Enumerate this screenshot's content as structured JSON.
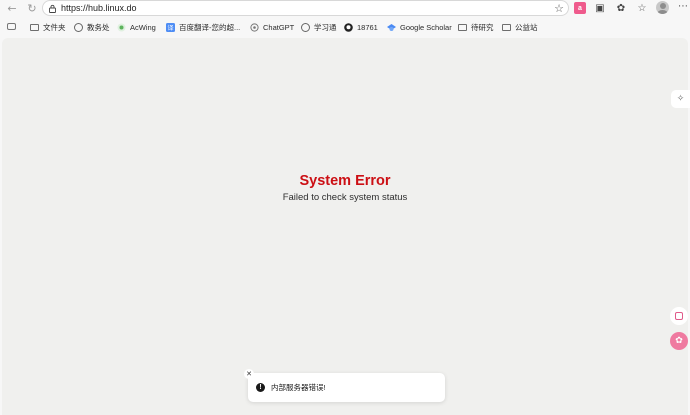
{
  "browser": {
    "url": "https://hub.linux.do"
  },
  "bookmarks": [
    {
      "label": "文件夹",
      "icon": "folder-icon"
    },
    {
      "label": "教务处",
      "icon": "globe-icon"
    },
    {
      "label": "AcWing",
      "icon": "acwing-icon"
    },
    {
      "label": "百度翻译-您的超...",
      "icon": "baidu-translate-icon"
    },
    {
      "label": "ChatGPT",
      "icon": "chatgpt-icon"
    },
    {
      "label": "学习通",
      "icon": "globe-icon"
    },
    {
      "label": "18761",
      "icon": "github-icon"
    },
    {
      "label": "Google Scholar",
      "icon": "scholar-icon"
    },
    {
      "label": "待研究",
      "icon": "folder-icon"
    },
    {
      "label": "公益站",
      "icon": "folder-icon"
    }
  ],
  "error": {
    "title": "System Error",
    "message": "Failed to check system status"
  },
  "toast": {
    "message": "内部服务器错误!"
  },
  "colors": {
    "error_title": "#cc0f14",
    "page_bg": "#f0f0ee",
    "toast_bg": "#ffffff"
  }
}
